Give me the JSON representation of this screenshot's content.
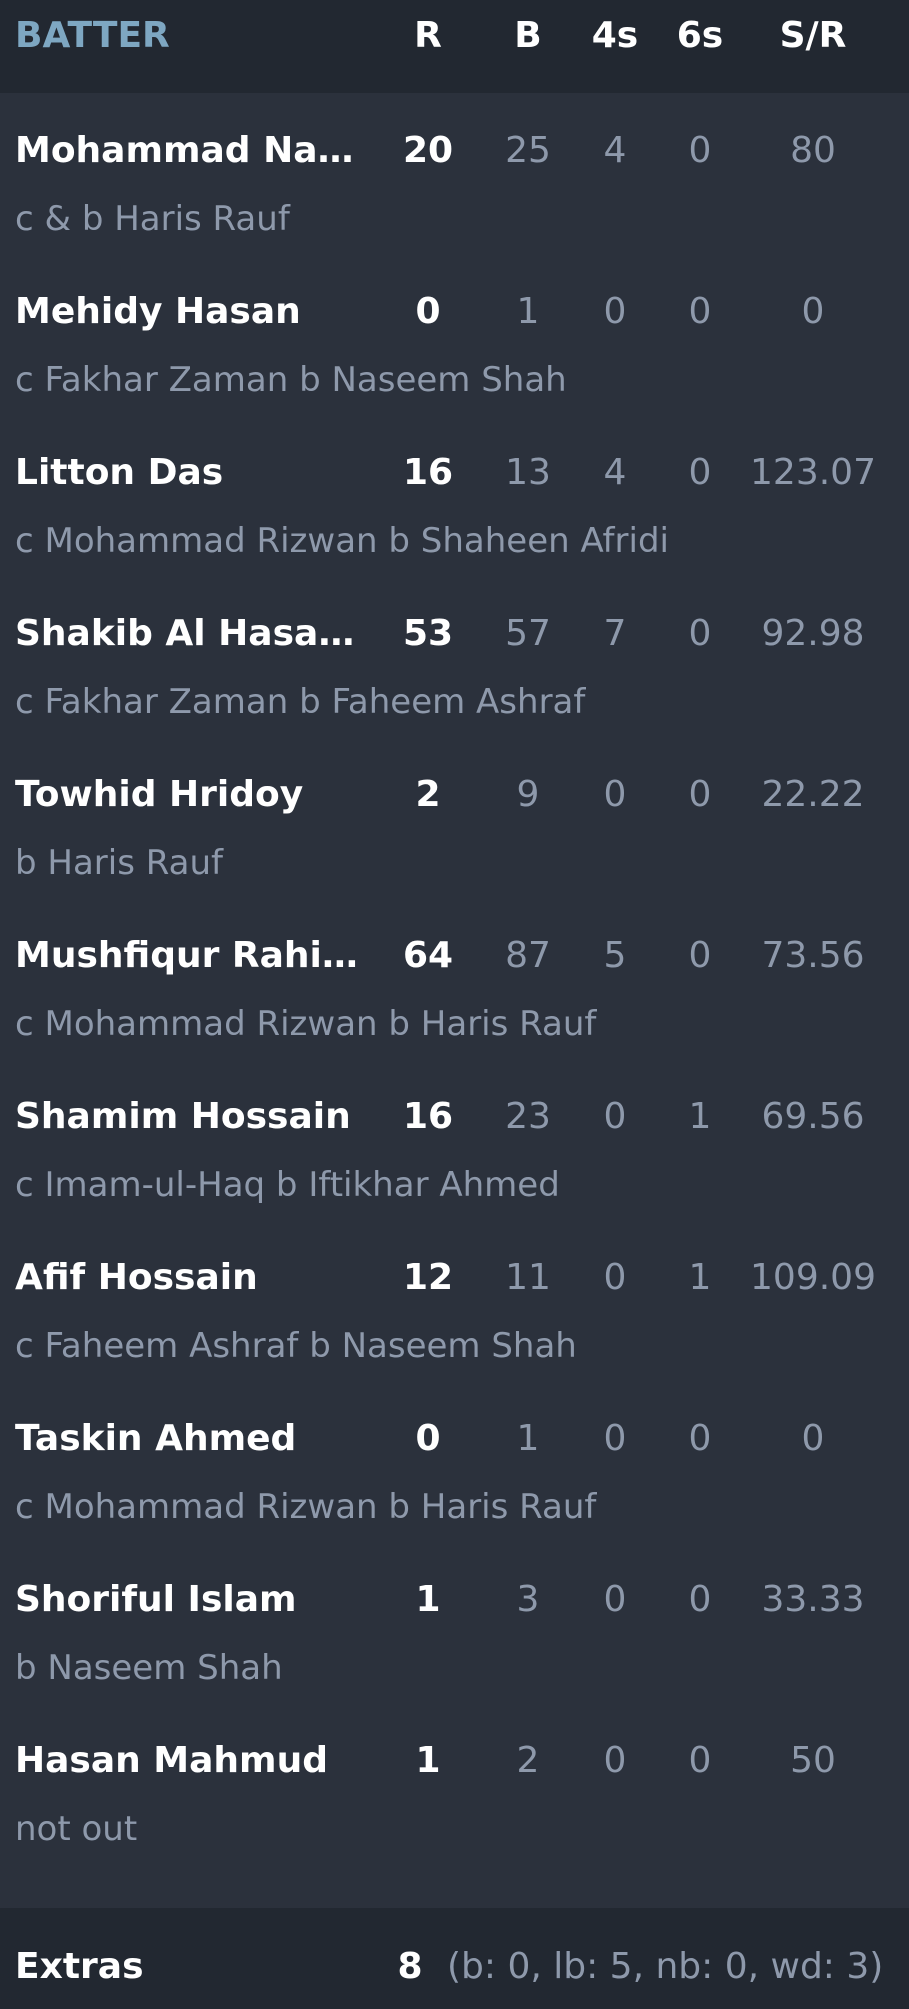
{
  "header": {
    "batter": "BATTER",
    "runs": "R",
    "balls": "B",
    "fours": "4s",
    "sixes": "6s",
    "strike_rate": "S/R"
  },
  "batters": [
    {
      "name": "Mohammad Naim",
      "dismissal": "c & b Haris Rauf",
      "r": "20",
      "b": "25",
      "fours": "4",
      "sixes": "0",
      "sr": "80"
    },
    {
      "name": "Mehidy Hasan",
      "dismissal": "c Fakhar Zaman b Naseem Shah",
      "r": "0",
      "b": "1",
      "fours": "0",
      "sixes": "0",
      "sr": "0"
    },
    {
      "name": "Litton Das",
      "dismissal": "c Mohammad Rizwan b Shaheen Afridi",
      "r": "16",
      "b": "13",
      "fours": "4",
      "sixes": "0",
      "sr": "123.07"
    },
    {
      "name": "Shakib Al Hasan (…",
      "dismissal": "c Fakhar Zaman b Faheem Ashraf",
      "r": "53",
      "b": "57",
      "fours": "7",
      "sixes": "0",
      "sr": "92.98"
    },
    {
      "name": "Towhid Hridoy",
      "dismissal": "b Haris Rauf",
      "r": "2",
      "b": "9",
      "fours": "0",
      "sixes": "0",
      "sr": "22.22"
    },
    {
      "name": "Mushfiqur Rahim…",
      "dismissal": "c Mohammad Rizwan b Haris Rauf",
      "r": "64",
      "b": "87",
      "fours": "5",
      "sixes": "0",
      "sr": "73.56"
    },
    {
      "name": "Shamim Hossain",
      "dismissal": "c Imam-ul-Haq b Iftikhar Ahmed",
      "r": "16",
      "b": "23",
      "fours": "0",
      "sixes": "1",
      "sr": "69.56"
    },
    {
      "name": "Afif Hossain",
      "dismissal": "c Faheem Ashraf b Naseem Shah",
      "r": "12",
      "b": "11",
      "fours": "0",
      "sixes": "1",
      "sr": "109.09"
    },
    {
      "name": "Taskin Ahmed",
      "dismissal": "c Mohammad Rizwan b Haris Rauf",
      "r": "0",
      "b": "1",
      "fours": "0",
      "sixes": "0",
      "sr": "0"
    },
    {
      "name": "Shoriful Islam",
      "dismissal": "b Naseem Shah",
      "r": "1",
      "b": "3",
      "fours": "0",
      "sixes": "0",
      "sr": "33.33"
    },
    {
      "name": "Hasan Mahmud",
      "dismissal": "not out",
      "r": "1",
      "b": "2",
      "fours": "0",
      "sixes": "0",
      "sr": "50"
    }
  ],
  "extras": {
    "label": "Extras",
    "total": "8",
    "detail": "(b: 0, lb: 5, nb: 0, wd: 3)"
  },
  "colors": {
    "background": "#2b313c",
    "header_background": "#222831",
    "accent": "#7ea7c2",
    "muted_text": "#8e99ab"
  }
}
